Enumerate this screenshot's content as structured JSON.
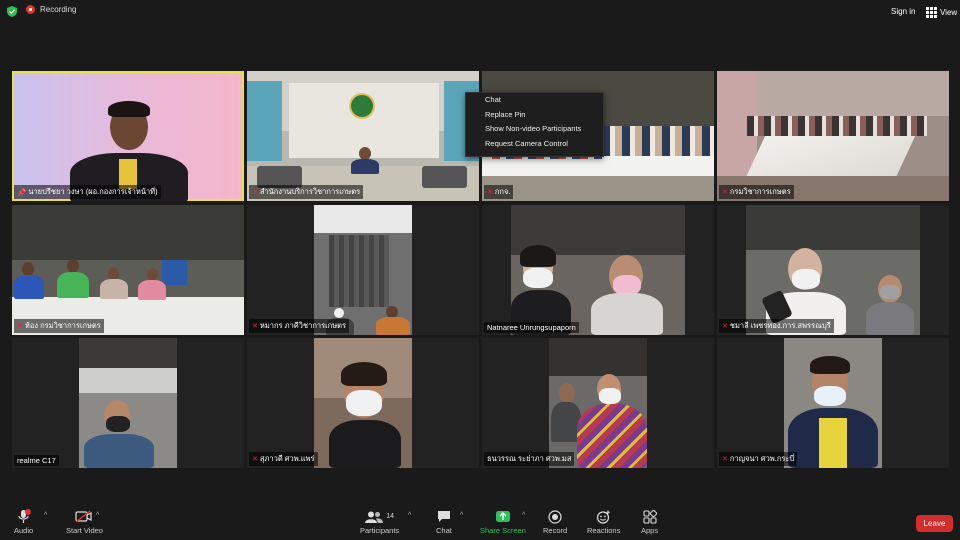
{
  "topbar": {
    "recording_label": "Recording",
    "signin_label": "Sign in",
    "view_label": "View"
  },
  "context_menu": {
    "items": [
      "Chat",
      "Replace Pin",
      "Show Non-video Participants",
      "Request Camera Control"
    ]
  },
  "tiles": [
    {
      "name": "นายปรีชยา วงษา (ผอ.กองการเจ้าหน้าที่)",
      "mic": "pin"
    },
    {
      "name": "สำนักงานบริการวิชาการเกษตร",
      "mic": "off"
    },
    {
      "name": "กกจ.",
      "mic": "off"
    },
    {
      "name": "กรมวิชาการเกษตร",
      "mic": "off"
    },
    {
      "name": "ห้อง กรมวิชาการเกษตร",
      "mic": "off"
    },
    {
      "name": "หมากร ภาคีวิชาการเกษตร",
      "mic": "off"
    },
    {
      "name": "Natnaree Unrungsupaporn",
      "mic": "none"
    },
    {
      "name": "ชมาลี เพชรทอง.การ.สพรรณบุรี",
      "mic": "off"
    },
    {
      "name": "realme C17",
      "mic": "none"
    },
    {
      "name": "สุภาวดี ศวพ.แพร่",
      "mic": "off"
    },
    {
      "name": "ธนวรรณ ระย่าภา ศวพ.มส",
      "mic": "none"
    },
    {
      "name": "กาญจนา ศวพ.กระบี่",
      "mic": "off"
    }
  ],
  "toolbar": {
    "audio_label": "Audio",
    "video_label": "Start Video",
    "participants_label": "Participants",
    "participants_count": "14",
    "chat_label": "Chat",
    "share_label": "Share Screen",
    "record_label": "Record",
    "reactions_label": "Reactions",
    "apps_label": "Apps",
    "leave_label": "Leave"
  },
  "colors": {
    "active_border": "#e6e04a",
    "share_green": "#2ec05a",
    "leave_red": "#d22c2c",
    "recording_red": "#e0342f"
  }
}
